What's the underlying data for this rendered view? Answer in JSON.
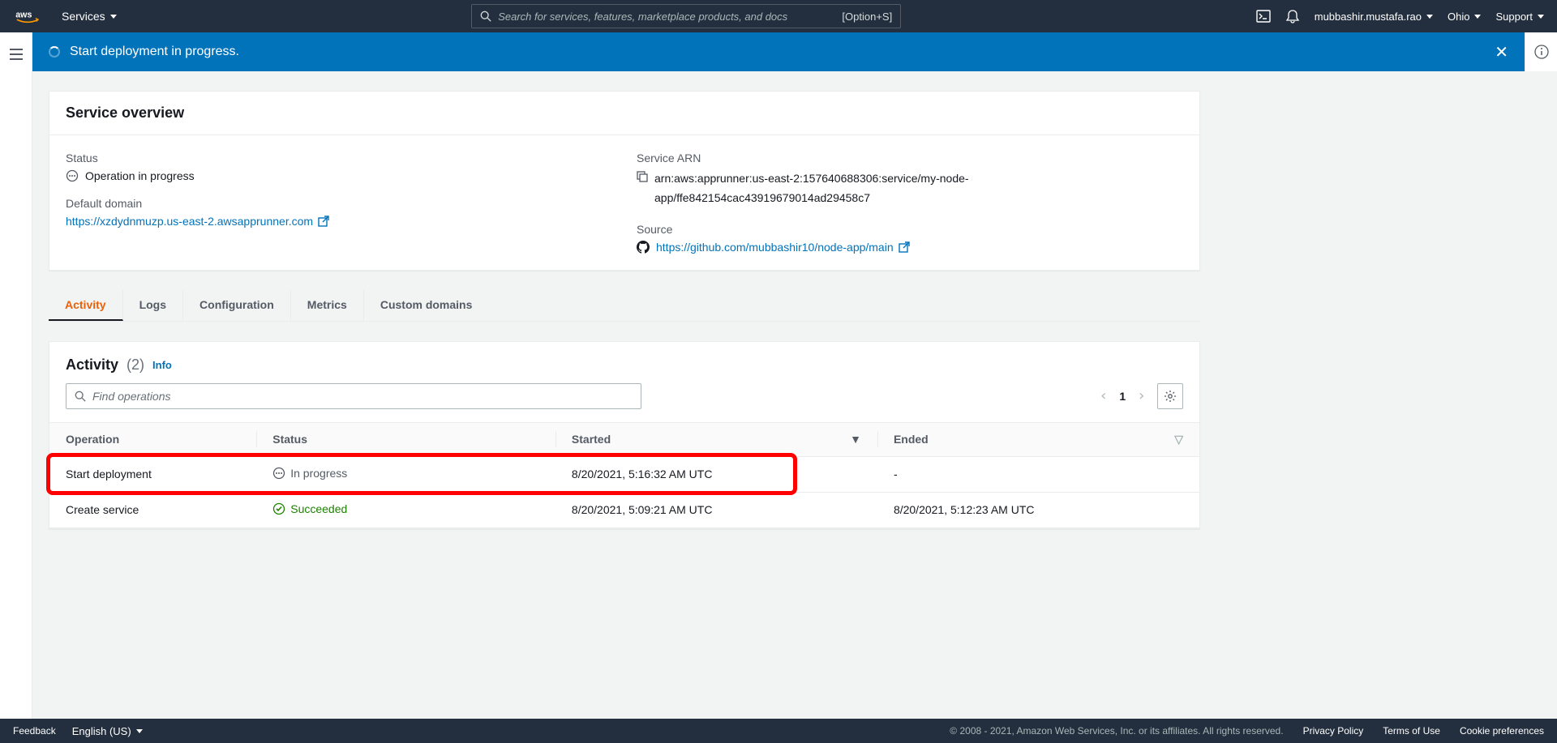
{
  "nav": {
    "services_label": "Services",
    "search_placeholder": "Search for services, features, marketplace products, and docs",
    "shortcut": "[Option+S]",
    "user": "mubbashir.mustafa.rao",
    "region": "Ohio",
    "support": "Support"
  },
  "banner": {
    "message": "Start deployment in progress."
  },
  "overview": {
    "title": "Service overview",
    "status_label": "Status",
    "status_value": "Operation in progress",
    "domain_label": "Default domain",
    "domain_url": "https://xzdydnmuzp.us-east-2.awsapprunner.com",
    "arn_label": "Service ARN",
    "arn_value": "arn:aws:apprunner:us-east-2:157640688306:service/my-node-app/ffe842154cac43919679014ad29458c7",
    "source_label": "Source",
    "source_url": "https://github.com/mubbashir10/node-app/main"
  },
  "tabs": [
    "Activity",
    "Logs",
    "Configuration",
    "Metrics",
    "Custom domains"
  ],
  "activity": {
    "title": "Activity",
    "count": "(2)",
    "info": "Info",
    "find_placeholder": "Find operations",
    "page": "1",
    "columns": {
      "operation": "Operation",
      "status": "Status",
      "started": "Started",
      "ended": "Ended"
    },
    "rows": [
      {
        "operation": "Start deployment",
        "status": "In progress",
        "status_type": "progress",
        "started": "8/20/2021, 5:16:32 AM UTC",
        "ended": "-"
      },
      {
        "operation": "Create service",
        "status": "Succeeded",
        "status_type": "success",
        "started": "8/20/2021, 5:09:21 AM UTC",
        "ended": "8/20/2021, 5:12:23 AM UTC"
      }
    ]
  },
  "footer": {
    "feedback": "Feedback",
    "language": "English (US)",
    "copyright": "© 2008 - 2021, Amazon Web Services, Inc. or its affiliates. All rights reserved.",
    "privacy": "Privacy Policy",
    "terms": "Terms of Use",
    "cookies": "Cookie preferences"
  }
}
